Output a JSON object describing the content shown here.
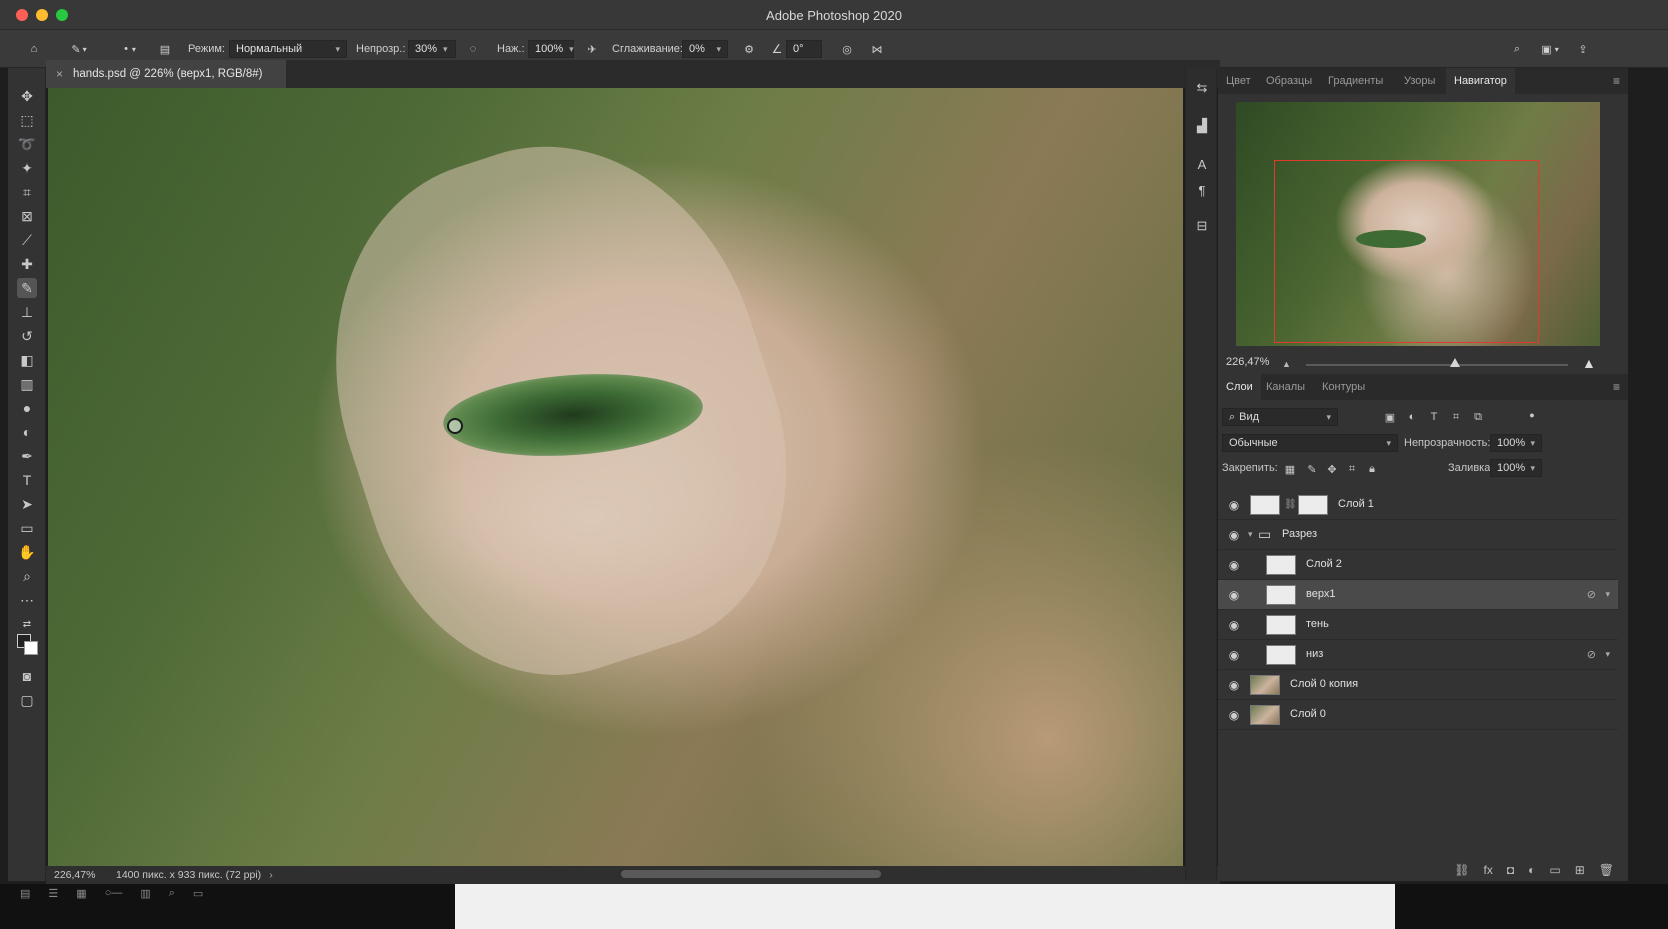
{
  "app": {
    "title": "Adobe Photoshop 2020"
  },
  "options": {
    "mode_label": "Режим:",
    "mode_value": "Нормальный",
    "opacity_label": "Непрозр.:",
    "opacity_value": "30%",
    "pressure_label": "Наж.:",
    "pressure_value": "100%",
    "smoothing_label": "Сглаживание:",
    "smoothing_value": "0%",
    "angle_value": "0°"
  },
  "document": {
    "tab_title": "hands.psd @ 226% (верх1, RGB/8#)",
    "zoom": "226,47%",
    "info": "1400 пикс. x 933 пикс. (72 ppi)"
  },
  "top_panel": {
    "tabs": [
      {
        "label": "Цвет"
      },
      {
        "label": "Образцы"
      },
      {
        "label": "Градиенты"
      },
      {
        "label": "Узоры"
      },
      {
        "label": "Навигатор"
      }
    ],
    "active_tab": "Навигатор",
    "zoom": "226,47%"
  },
  "layers_panel": {
    "tabs": [
      {
        "label": "Слои"
      },
      {
        "label": "Каналы"
      },
      {
        "label": "Контуры"
      }
    ],
    "filter_value": "Вид",
    "blend_mode": "Обычные",
    "opacity_label": "Непрозрачность:",
    "opacity_value": "100%",
    "lock_label": "Закрепить:",
    "fill_label": "Заливка:",
    "fill_value": "100%",
    "layers": [
      {
        "name": "Слой 1",
        "selected": false
      },
      {
        "name": "Разрез",
        "selected": false
      },
      {
        "name": "Слой 2",
        "selected": false
      },
      {
        "name": "верх1",
        "selected": true
      },
      {
        "name": "тень",
        "selected": false
      },
      {
        "name": "низ",
        "selected": false
      },
      {
        "name": "Слой 0 копия",
        "selected": false
      },
      {
        "name": "Слой 0",
        "selected": false
      }
    ]
  },
  "colors": {
    "accent_frame": "#e03a2c",
    "panel_bg": "#333333",
    "selected_row": "#4a4a4a"
  }
}
